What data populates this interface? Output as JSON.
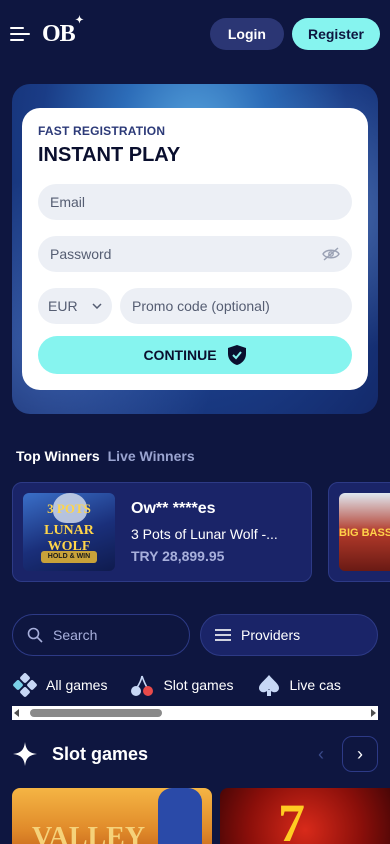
{
  "header": {
    "logo": "OB",
    "login_label": "Login",
    "register_label": "Register"
  },
  "registration": {
    "subtitle": "FAST REGISTRATION",
    "title": "INSTANT PLAY",
    "email_placeholder": "Email",
    "password_placeholder": "Password",
    "currency": "EUR",
    "promo_placeholder": "Promo code (optional)",
    "continue_label": "CONTINUE"
  },
  "winners": {
    "tabs": [
      "Top Winners",
      "Live Winners"
    ],
    "card": {
      "name": "Ow** ****es",
      "game": "3 Pots of Lunar Wolf -...",
      "amount": "TRY 28,899.95",
      "thumb_line1": "3 POTS",
      "thumb_line2": "LUNAR WOLF",
      "thumb_badge": "HOLD & WIN"
    },
    "card2_thumb": "BIG BASS"
  },
  "search": {
    "placeholder": "Search"
  },
  "providers": {
    "label": "Providers"
  },
  "categories": [
    "All games",
    "Slot games",
    "Live cas"
  ],
  "slots": {
    "title": "Slot games",
    "prev": "‹",
    "next": "›",
    "game1_text": "VALLEY",
    "game2_text": "7"
  },
  "colors": {
    "background": "#0e1640",
    "accent": "#86f4ef",
    "card": "#1a2468"
  }
}
